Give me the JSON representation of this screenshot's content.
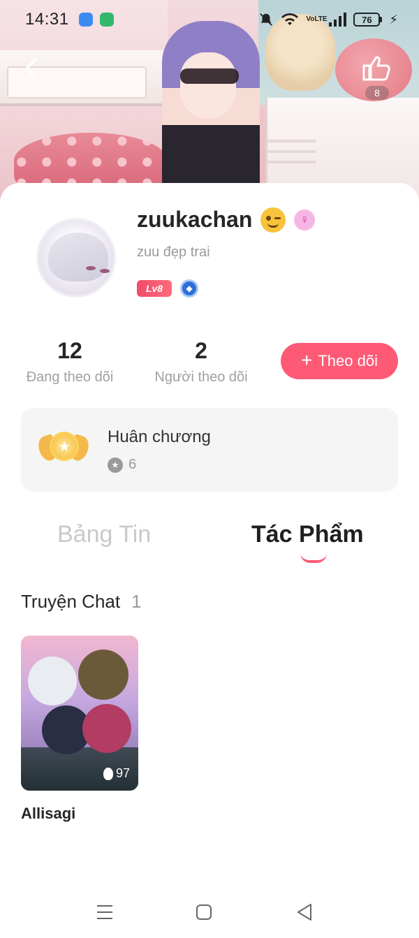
{
  "status_bar": {
    "time": "14:31",
    "battery": "76",
    "network": "VoLTE"
  },
  "header": {
    "like_count": "8"
  },
  "profile": {
    "username": "zuukachan",
    "bio": "zuu đẹp trai",
    "level": "Lv8",
    "gender_symbol": "♀"
  },
  "stats": {
    "following": {
      "value": "12",
      "label": "Đang theo dõi"
    },
    "followers": {
      "value": "2",
      "label": "Người theo dõi"
    }
  },
  "follow_button": {
    "label": "Theo dõi"
  },
  "medals": {
    "title": "Huân chương",
    "count": "6"
  },
  "tabs": [
    {
      "label": "Bảng Tin",
      "active": false
    },
    {
      "label": "Tác Phẩm",
      "active": true
    }
  ],
  "section": {
    "title": "Truyện Chat",
    "count": "1"
  },
  "stories": [
    {
      "title": "Allisagi",
      "views": "97"
    }
  ],
  "colors": {
    "accent": "#fe5a76",
    "level_badge": "#f04b6b",
    "muted_text": "#9a9a9a"
  },
  "icons": [
    "back-arrow-icon",
    "thumbs-up-icon",
    "female-icon",
    "level-badge-icon",
    "gem-icon",
    "medal-icon",
    "star-icon",
    "fire-icon",
    "menu-icon",
    "home-square-icon",
    "back-triangle-icon"
  ]
}
